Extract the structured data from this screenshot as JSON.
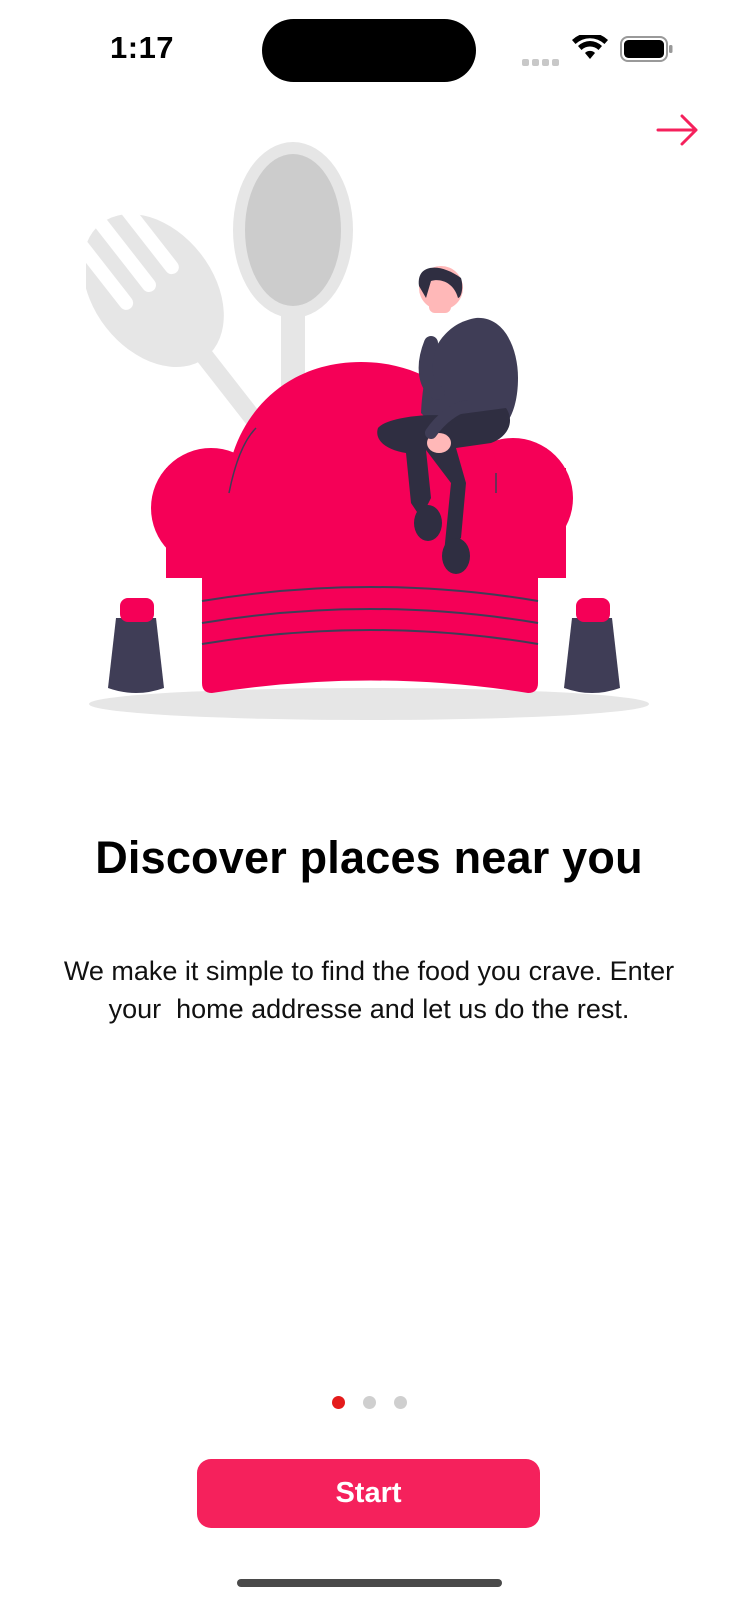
{
  "status_bar": {
    "time": "1:17"
  },
  "header": {
    "skip_icon": "arrow-right-icon"
  },
  "onboarding": {
    "title": "Discover places near you",
    "description": "We make it simple to find the food you crave. Enter\nyour  home addresse and let us do the rest.",
    "pages_total": 3,
    "current_page": 1
  },
  "actions": {
    "start_label": "Start"
  },
  "colors": {
    "accent": "#f5215c",
    "active_dot": "#e41b1b",
    "inactive_dot": "#cfcfcf"
  }
}
